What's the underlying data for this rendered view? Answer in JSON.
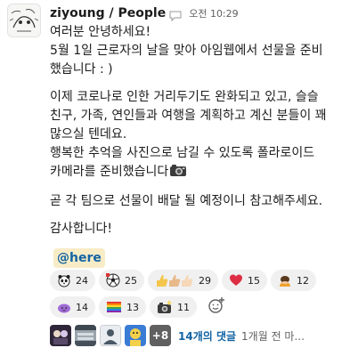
{
  "message": {
    "author": "ziyoung / People",
    "status_icon": "speech-bubble-icon",
    "timestamp": "오전 10:29",
    "paragraphs": [
      [
        "여러분 안녕하세요!",
        "5월 1일 근로자의 날을 맞아 아임웹에서 선물을 준비",
        "했습니다 : )"
      ],
      [
        "이제 코로나로 인한 거리두기도 완화되고 있고, 슬슬",
        "친구, 가족, 연인들과 여행을 계획하고 계신 분들이 꽤",
        "많으실 텐데요.",
        "행복한 추억을 사진으로 남길 수 있도록 폴라로이드",
        "카메라를 준비했습니다"
      ],
      [
        "곧 각 팀으로 선물이 배달 될 예정이니 참고해주세요."
      ],
      [
        "감사합니다!"
      ]
    ],
    "inline_emoji": "camera-icon",
    "mention": "@here"
  },
  "reactions": [
    {
      "icon": "panda-icon",
      "count": "24"
    },
    {
      "icon": "soccer-ball-icon",
      "count": "25"
    },
    {
      "icon": "thumbs-up-icon",
      "count": "29"
    },
    {
      "icon": "red-heart-icon",
      "count": "15"
    },
    {
      "icon": "bowing-person-icon",
      "count": "12"
    },
    {
      "icon": "purple-blob-icon",
      "count": "14"
    },
    {
      "icon": "rainbow-flag-icon",
      "count": "13"
    },
    {
      "icon": "camera-flash-icon",
      "count": "11"
    }
  ],
  "add_reaction_icon": "add-reaction-icon",
  "thread": {
    "more_participants": "+8",
    "reply_count": "14개의 댓글",
    "last_reply": "1개월 전 마..."
  },
  "colors": {
    "link": "#1264a3",
    "mention_bg": "#f8ecc7",
    "reaction_bg": "#f0f0f0",
    "muted": "#616061"
  }
}
